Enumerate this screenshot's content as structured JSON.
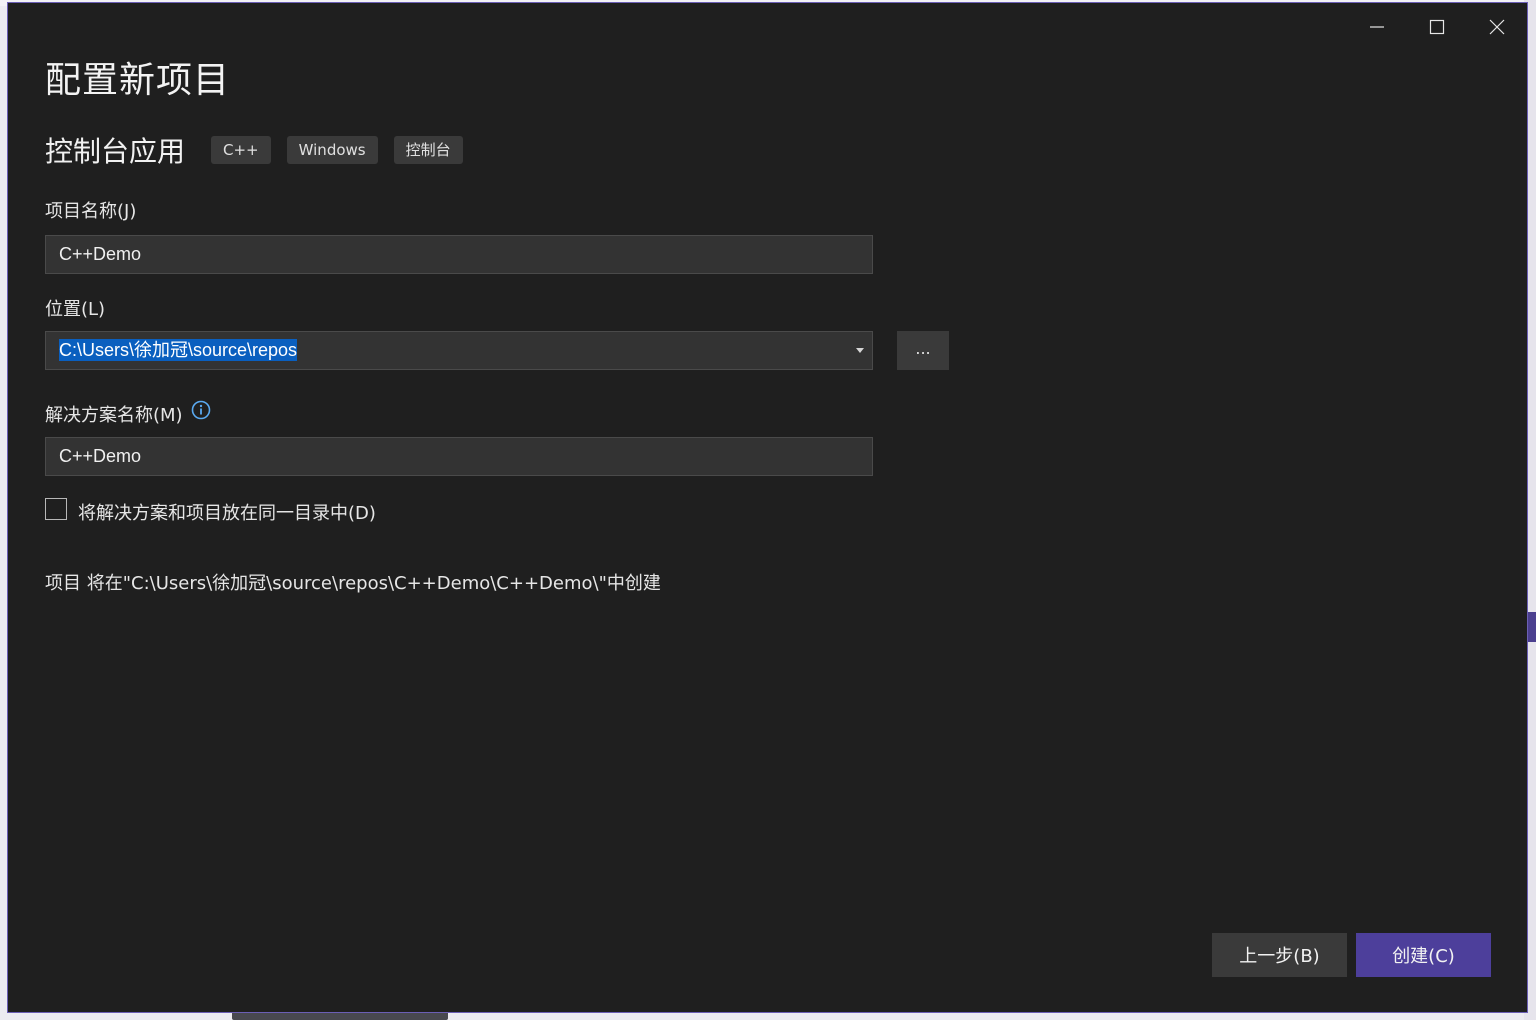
{
  "window": {
    "controls": [
      "minimize-icon",
      "maximize-icon",
      "close-icon"
    ]
  },
  "title": "配置新项目",
  "template": {
    "name": "控制台应用",
    "tags": [
      "C++",
      "Windows",
      "控制台"
    ]
  },
  "fields": {
    "project_name": {
      "label": "项目名称(J)",
      "value": "C++Demo"
    },
    "location": {
      "label": "位置(L)",
      "value": "C:\\Users\\徐加冠\\source\\repos",
      "browse_label": "..."
    },
    "solution_name": {
      "label": "解决方案名称(M)",
      "value": "C++Demo",
      "info_icon": "info-icon"
    }
  },
  "same_dir_checkbox": {
    "label": "将解决方案和项目放在同一目录中(D)",
    "checked": false
  },
  "path_note": "项目 将在\"C:\\Users\\徐加冠\\source\\repos\\C++Demo\\C++Demo\\\"中创建",
  "buttons": {
    "back": "上一步(B)",
    "create": "创建(C)"
  },
  "colors": {
    "dialog_bg": "#1f1f1f",
    "accent": "#4d3f9b",
    "selection": "#0a5fbf"
  }
}
